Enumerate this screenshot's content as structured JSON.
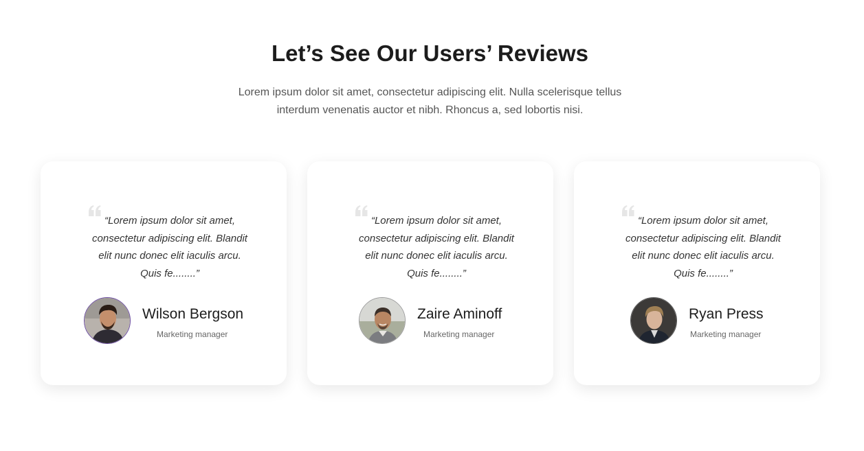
{
  "section": {
    "title": "Let’s See Our Users’ Reviews",
    "subtitle": "Lorem ipsum dolor sit amet, consectetur adipiscing elit. Nulla scelerisque tellus interdum venenatis auctor et nibh. Rhoncus a, sed lobortis nisi."
  },
  "reviews": [
    {
      "quote": "“Lorem ipsum dolor sit amet, consectetur adipiscing elit. Blandit elit nunc donec elit iaculis arcu. Quis fe........”",
      "name": "Wilson Bergson",
      "role": "Marketing manager",
      "avatar_icon": "person-photo-avatar"
    },
    {
      "quote": "“Lorem ipsum dolor sit amet, consectetur adipiscing elit. Blandit elit nunc donec elit iaculis arcu. Quis fe........”",
      "name": "Zaire Aminoff",
      "role": "Marketing manager",
      "avatar_icon": "person-photo-avatar"
    },
    {
      "quote": "“Lorem ipsum dolor sit amet, consectetur adipiscing elit. Blandit elit nunc donec elit iaculis arcu. Quis fe........”",
      "name": "Ryan Press",
      "role": "Marketing manager",
      "avatar_icon": "person-photo-avatar"
    }
  ],
  "colors": {
    "background": "#ffffff",
    "title": "#1c1c1c",
    "body_text": "#555555",
    "quote_mark": "#e6e6e6"
  }
}
